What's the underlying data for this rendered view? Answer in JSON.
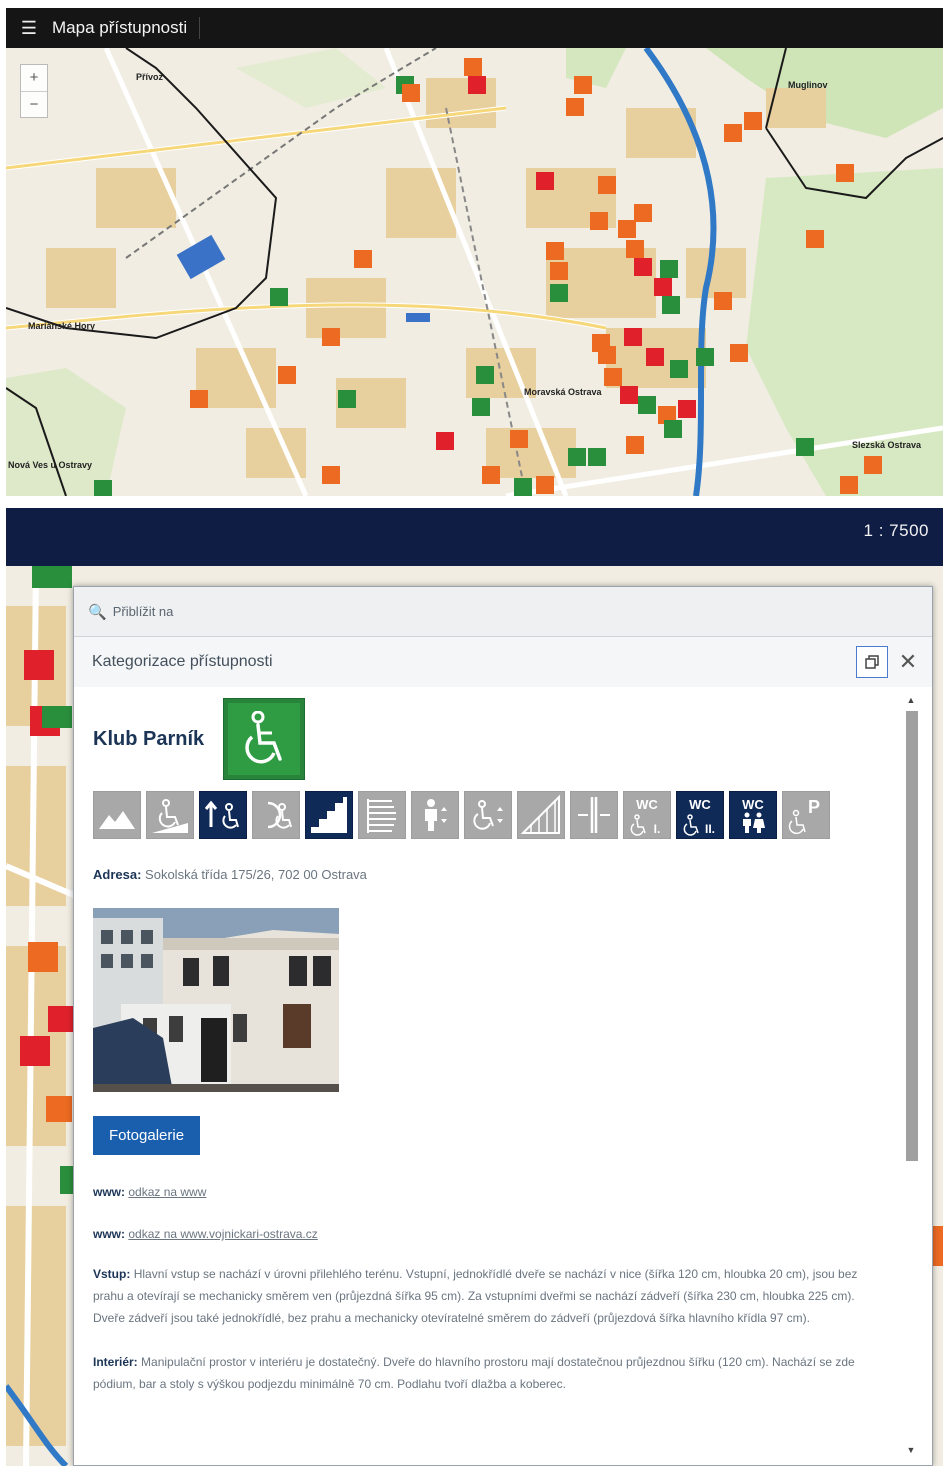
{
  "screen1": {
    "app_title": "Mapa přístupnosti",
    "menu_icon": "hamburger-menu-icon",
    "zoom_in": "+",
    "zoom_out": "−",
    "map_labels": [
      {
        "text": "Přívoz"
      },
      {
        "text": "Muglinov"
      },
      {
        "text": "Mariánské Hory"
      },
      {
        "text": "Moravská Ostrava"
      },
      {
        "text": "Slezská Ostrava"
      },
      {
        "text": "Nová Ves u Ostravy"
      }
    ]
  },
  "screen2": {
    "scale": "1 : 7500",
    "popup": {
      "zoom_to": "Přiblížit na",
      "title": "Kategorizace přístupnosti",
      "place_name": "Klub Parník",
      "access_icon": "wheelchair-icon",
      "access_color": "#2f9c44",
      "accessibility_icons": [
        {
          "name": "terrain-icon",
          "active": false
        },
        {
          "name": "wheelchair-ramp-icon",
          "active": false
        },
        {
          "name": "entrance-up-icon",
          "active": true
        },
        {
          "name": "entrance-back-icon",
          "active": false
        },
        {
          "name": "stairs-icon",
          "active": true
        },
        {
          "name": "staircase-icon",
          "active": false
        },
        {
          "name": "elevator-person-icon",
          "active": false
        },
        {
          "name": "elevator-wheelchair-icon",
          "active": false
        },
        {
          "name": "platform-icon",
          "active": false
        },
        {
          "name": "door-icon",
          "active": false
        },
        {
          "name": "wc-one-icon",
          "active": false,
          "text": "WC",
          "sub": "I."
        },
        {
          "name": "wc-two-icon",
          "active": true,
          "text": "WC",
          "sub": "II."
        },
        {
          "name": "wc-family-icon",
          "active": true,
          "text": "WC"
        },
        {
          "name": "parking-icon",
          "active": false,
          "text": "P"
        }
      ],
      "address_label": "Adresa:",
      "address": "Sokolská třída 175/26, 702 00 Ostrava",
      "gallery_button": "Fotogalerie",
      "www1_label": "www:",
      "www1_link": "odkaz na www",
      "www2_label": "www:",
      "www2_link": "odkaz na www.vojnickari-ostrava.cz",
      "entry_label": "Vstup:",
      "entry_text": "Hlavní vstup se nachází v úrovni přilehlého terénu. Vstupní, jednokřídlé dveře se nachází v nice (šířka 120 cm, hloubka 20 cm), jsou bez prahu a otevírají se mechanicky směrem ven (průjezdná šířka 95 cm). Za vstupními dveřmi se nachází zádveří (šířka 230 cm, hloubka 225 cm). Dveře zádveří jsou také jednokřídlé, bez prahu a mechanicky otevíratelné směrem do zádveří (průjezdová šířka hlavního křídla 97 cm).",
      "interior_label": "Interiér:",
      "interior_text": "Manipulační prostor v interiéru je dostatečný. Dveře do hlavního prostoru mají dostatečnou průjezdnou šířku (120 cm). Nachází se zde pódium, bar a stoly s výškou podjezdu minimálně 70 cm. Podlahu tvoří dlažba a koberec."
    }
  },
  "colors": {
    "topbar": "#151515",
    "navbar": "#0f1d45",
    "accent_blue": "#1a5fae",
    "active_icon": "#0f2a57",
    "poi_orange": "#ec6a22",
    "poi_red": "#e0212b",
    "poi_green": "#2a8f3c"
  }
}
